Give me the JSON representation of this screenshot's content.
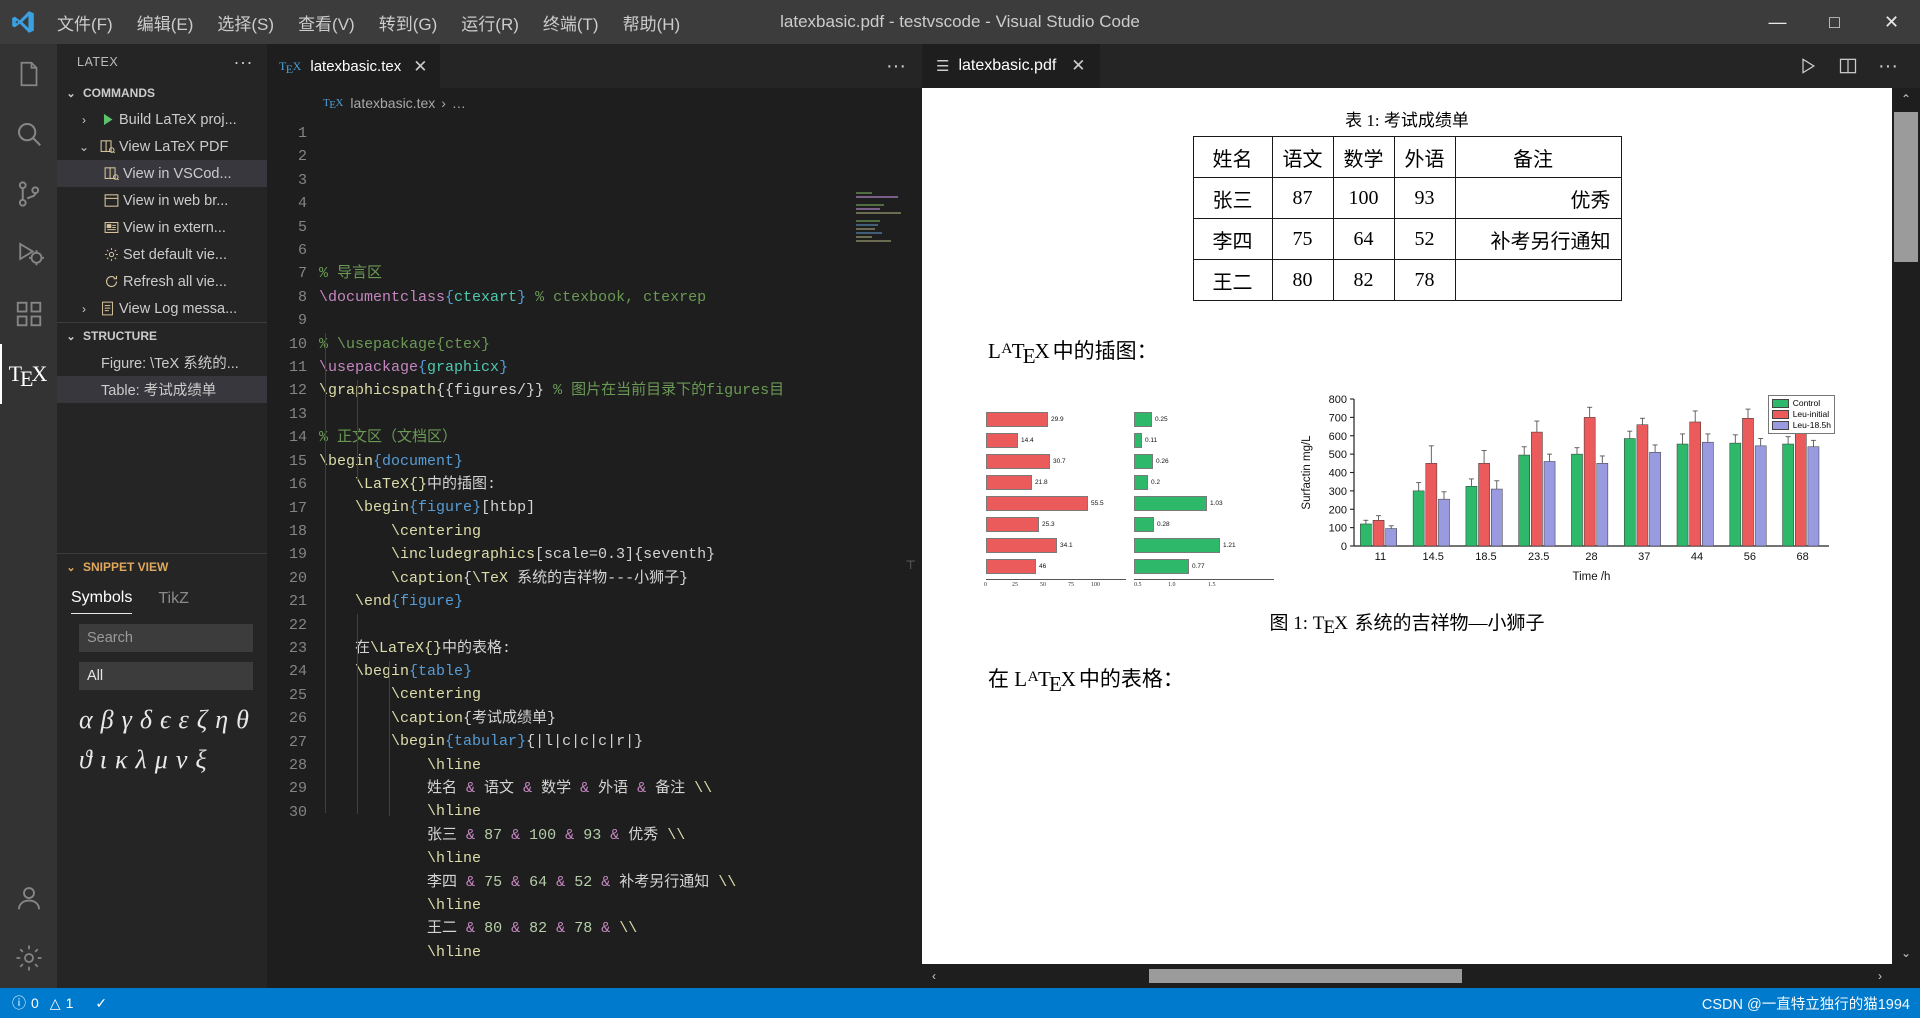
{
  "titlebar": {
    "menus": [
      "文件(F)",
      "编辑(E)",
      "选择(S)",
      "查看(V)",
      "转到(G)",
      "运行(R)",
      "终端(T)",
      "帮助(H)"
    ],
    "window_title": "latexbasic.pdf - testvscode - Visual Studio Code",
    "minimize": "—",
    "maximize": "▢",
    "close": "✕"
  },
  "activitybar": {
    "items": [
      {
        "name": "explorer",
        "icon": "files-icon"
      },
      {
        "name": "search",
        "icon": "search-icon"
      },
      {
        "name": "source-control",
        "icon": "source-control-icon"
      },
      {
        "name": "run-debug",
        "icon": "run-debug-icon"
      },
      {
        "name": "extensions",
        "icon": "extensions-icon"
      },
      {
        "name": "latex",
        "icon": "tex-icon",
        "label": "TeX"
      },
      {
        "name": "accounts",
        "icon": "account-icon"
      },
      {
        "name": "settings",
        "icon": "gear-icon"
      }
    ]
  },
  "sidebar": {
    "title": "LATEX",
    "more_actions": "···",
    "commands": {
      "label": "COMMANDS",
      "items": [
        {
          "label": "Build LaTeX proj...",
          "icon": "play-icon",
          "chevron": "›",
          "indent": 1
        },
        {
          "label": "View LaTeX PDF",
          "icon": "preview-icon",
          "chevron": "⌄",
          "indent": 1
        },
        {
          "label": "View in VSCod...",
          "icon": "preview-icon",
          "chevron": "",
          "indent": 2,
          "selected": true
        },
        {
          "label": "View in web br...",
          "icon": "browser-icon",
          "chevron": "",
          "indent": 2
        },
        {
          "label": "View in extern...",
          "icon": "external-icon",
          "chevron": "",
          "indent": 2
        },
        {
          "label": "Set default vie...",
          "icon": "gear-icon",
          "chevron": "",
          "indent": 2
        },
        {
          "label": "Refresh all vie...",
          "icon": "refresh-icon",
          "chevron": "",
          "indent": 2
        },
        {
          "label": "View Log messa...",
          "icon": "log-icon",
          "chevron": "›",
          "indent": 1
        }
      ]
    },
    "structure": {
      "label": "STRUCTURE",
      "items": [
        {
          "label": "Figure: \\TeX 系统的...",
          "selected": false
        },
        {
          "label": "Table: 考试成绩单",
          "selected": true
        }
      ]
    },
    "snippet_view": {
      "label": "SNIPPET VIEW",
      "tabs": [
        {
          "label": "Symbols",
          "active": true
        },
        {
          "label": "TikZ",
          "active": false
        }
      ],
      "search_placeholder": "Search",
      "filter_value": "All",
      "symbols": [
        "α",
        "β",
        "γ",
        "δ",
        "ϵ",
        "ε",
        "ζ",
        "η",
        "θ",
        "ϑ",
        "ι",
        "κ",
        "λ",
        "μ",
        "ν",
        "ξ"
      ]
    }
  },
  "editor": {
    "tab": {
      "label": "latexbasic.tex",
      "icon": "tex-icon",
      "close": "✕"
    },
    "more_actions": "···",
    "breadcrumb": {
      "file": "latexbasic.tex",
      "sep": "›",
      "rest": "…",
      "icon": "tex-icon"
    },
    "lines": [
      {
        "n": 1,
        "tokens": [
          {
            "t": "% 导言区",
            "c": "c"
          }
        ]
      },
      {
        "n": 2,
        "tokens": [
          {
            "t": "\\documentclass",
            "c": "kw"
          },
          {
            "t": "{",
            "c": "br"
          },
          {
            "t": "ctexart",
            "c": "nm"
          },
          {
            "t": "}",
            "c": "br"
          },
          {
            "t": " % ctexbook, ctexrep",
            "c": "c"
          }
        ]
      },
      {
        "n": 3,
        "tokens": []
      },
      {
        "n": 4,
        "tokens": [
          {
            "t": "% \\usepackage{ctex}",
            "c": "c"
          }
        ]
      },
      {
        "n": 5,
        "tokens": [
          {
            "t": "\\usepackage",
            "c": "kw"
          },
          {
            "t": "{",
            "c": "br"
          },
          {
            "t": "graphicx",
            "c": "nm"
          },
          {
            "t": "}",
            "c": "br"
          }
        ]
      },
      {
        "n": 6,
        "tokens": [
          {
            "t": "\\graphicspath",
            "c": "fn"
          },
          {
            "t": "{{figures/}}",
            "c": "pl"
          },
          {
            "t": " % 图片在当前目录下的figures目",
            "c": "c"
          }
        ]
      },
      {
        "n": 7,
        "tokens": []
      },
      {
        "n": 8,
        "tokens": [
          {
            "t": "% 正文区（文档区）",
            "c": "c"
          }
        ]
      },
      {
        "n": 9,
        "tokens": [
          {
            "t": "\\begin",
            "c": "fn"
          },
          {
            "t": "{",
            "c": "br"
          },
          {
            "t": "document",
            "c": "br"
          },
          {
            "t": "}",
            "c": "br"
          }
        ]
      },
      {
        "n": 10,
        "tokens": [
          {
            "t": "    ",
            "c": "pl"
          },
          {
            "t": "\\LaTeX{}",
            "c": "fn"
          },
          {
            "t": "中的插图:",
            "c": "pl"
          }
        ]
      },
      {
        "n": 11,
        "tokens": [
          {
            "t": "    ",
            "c": "pl"
          },
          {
            "t": "\\begin",
            "c": "fn"
          },
          {
            "t": "{",
            "c": "br"
          },
          {
            "t": "figure",
            "c": "br"
          },
          {
            "t": "}",
            "c": "br"
          },
          {
            "t": "[htbp]",
            "c": "pl"
          }
        ]
      },
      {
        "n": 12,
        "tokens": [
          {
            "t": "        ",
            "c": "pl"
          },
          {
            "t": "\\centering",
            "c": "fn"
          }
        ]
      },
      {
        "n": 13,
        "tokens": [
          {
            "t": "        ",
            "c": "pl"
          },
          {
            "t": "\\includegraphics",
            "c": "fn"
          },
          {
            "t": "[scale=0.3]{seventh}",
            "c": "pl"
          }
        ]
      },
      {
        "n": 14,
        "tokens": [
          {
            "t": "        ",
            "c": "pl"
          },
          {
            "t": "\\caption",
            "c": "fn"
          },
          {
            "t": "{",
            "c": "pl"
          },
          {
            "t": "\\TeX",
            "c": "fn"
          },
          {
            "t": " 系统的吉祥物---小狮子}",
            "c": "pl"
          }
        ]
      },
      {
        "n": 15,
        "tokens": [
          {
            "t": "    ",
            "c": "pl"
          },
          {
            "t": "\\end",
            "c": "fn"
          },
          {
            "t": "{",
            "c": "br"
          },
          {
            "t": "figure",
            "c": "br"
          },
          {
            "t": "}",
            "c": "br"
          }
        ]
      },
      {
        "n": 16,
        "tokens": []
      },
      {
        "n": 17,
        "tokens": [
          {
            "t": "    在",
            "c": "pl"
          },
          {
            "t": "\\LaTeX{}",
            "c": "fn"
          },
          {
            "t": "中的表格:",
            "c": "pl"
          }
        ]
      },
      {
        "n": 18,
        "tokens": [
          {
            "t": "    ",
            "c": "pl"
          },
          {
            "t": "\\begin",
            "c": "fn"
          },
          {
            "t": "{",
            "c": "br"
          },
          {
            "t": "table",
            "c": "br"
          },
          {
            "t": "}",
            "c": "br"
          }
        ]
      },
      {
        "n": 19,
        "tokens": [
          {
            "t": "        ",
            "c": "pl"
          },
          {
            "t": "\\centering",
            "c": "fn"
          }
        ]
      },
      {
        "n": 20,
        "tokens": [
          {
            "t": "        ",
            "c": "pl"
          },
          {
            "t": "\\caption",
            "c": "fn"
          },
          {
            "t": "{考试成绩单}",
            "c": "pl"
          }
        ]
      },
      {
        "n": 21,
        "tokens": [
          {
            "t": "        ",
            "c": "pl"
          },
          {
            "t": "\\begin",
            "c": "fn"
          },
          {
            "t": "{",
            "c": "br"
          },
          {
            "t": "tabular",
            "c": "br"
          },
          {
            "t": "}",
            "c": "br"
          },
          {
            "t": "{|l|c|c|c|r|}",
            "c": "pl"
          }
        ]
      },
      {
        "n": 22,
        "tokens": [
          {
            "t": "            ",
            "c": "pl"
          },
          {
            "t": "\\hline",
            "c": "fn"
          }
        ]
      },
      {
        "n": 23,
        "tokens": [
          {
            "t": "            姓名 ",
            "c": "pl"
          },
          {
            "t": "&",
            "c": "amp"
          },
          {
            "t": " 语文 ",
            "c": "pl"
          },
          {
            "t": "&",
            "c": "amp"
          },
          {
            "t": " 数学 ",
            "c": "pl"
          },
          {
            "t": "&",
            "c": "amp"
          },
          {
            "t": " 外语 ",
            "c": "pl"
          },
          {
            "t": "&",
            "c": "amp"
          },
          {
            "t": " 备注 ",
            "c": "pl"
          },
          {
            "t": "\\\\",
            "c": "fn"
          }
        ]
      },
      {
        "n": 24,
        "tokens": [
          {
            "t": "            ",
            "c": "pl"
          },
          {
            "t": "\\hline",
            "c": "fn"
          }
        ]
      },
      {
        "n": 25,
        "tokens": [
          {
            "t": "            张三 ",
            "c": "pl"
          },
          {
            "t": "&",
            "c": "amp"
          },
          {
            "t": " ",
            "c": "pl"
          },
          {
            "t": "87",
            "c": "nu"
          },
          {
            "t": " ",
            "c": "pl"
          },
          {
            "t": "&",
            "c": "amp"
          },
          {
            "t": " ",
            "c": "pl"
          },
          {
            "t": "100",
            "c": "nu"
          },
          {
            "t": " ",
            "c": "pl"
          },
          {
            "t": "&",
            "c": "amp"
          },
          {
            "t": " ",
            "c": "pl"
          },
          {
            "t": "93",
            "c": "nu"
          },
          {
            "t": " ",
            "c": "pl"
          },
          {
            "t": "&",
            "c": "amp"
          },
          {
            "t": " 优秀 ",
            "c": "pl"
          },
          {
            "t": "\\\\",
            "c": "fn"
          }
        ]
      },
      {
        "n": 26,
        "tokens": [
          {
            "t": "            ",
            "c": "pl"
          },
          {
            "t": "\\hline",
            "c": "fn"
          }
        ]
      },
      {
        "n": 27,
        "tokens": [
          {
            "t": "            李四 ",
            "c": "pl"
          },
          {
            "t": "&",
            "c": "amp"
          },
          {
            "t": " ",
            "c": "pl"
          },
          {
            "t": "75",
            "c": "nu"
          },
          {
            "t": " ",
            "c": "pl"
          },
          {
            "t": "&",
            "c": "amp"
          },
          {
            "t": " ",
            "c": "pl"
          },
          {
            "t": "64",
            "c": "nu"
          },
          {
            "t": " ",
            "c": "pl"
          },
          {
            "t": "&",
            "c": "amp"
          },
          {
            "t": " ",
            "c": "pl"
          },
          {
            "t": "52",
            "c": "nu"
          },
          {
            "t": " ",
            "c": "pl"
          },
          {
            "t": "&",
            "c": "amp"
          },
          {
            "t": " 补考另行通知 ",
            "c": "pl"
          },
          {
            "t": "\\\\",
            "c": "fn"
          }
        ]
      },
      {
        "n": 28,
        "tokens": [
          {
            "t": "            ",
            "c": "pl"
          },
          {
            "t": "\\hline",
            "c": "fn"
          }
        ]
      },
      {
        "n": 29,
        "tokens": [
          {
            "t": "            王二 ",
            "c": "pl"
          },
          {
            "t": "&",
            "c": "amp"
          },
          {
            "t": " ",
            "c": "pl"
          },
          {
            "t": "80",
            "c": "nu"
          },
          {
            "t": " ",
            "c": "pl"
          },
          {
            "t": "&",
            "c": "amp"
          },
          {
            "t": " ",
            "c": "pl"
          },
          {
            "t": "82",
            "c": "nu"
          },
          {
            "t": " ",
            "c": "pl"
          },
          {
            "t": "&",
            "c": "amp"
          },
          {
            "t": " ",
            "c": "pl"
          },
          {
            "t": "78",
            "c": "nu"
          },
          {
            "t": " ",
            "c": "pl"
          },
          {
            "t": "&",
            "c": "amp"
          },
          {
            "t": " ",
            "c": "pl"
          },
          {
            "t": "\\\\",
            "c": "fn"
          }
        ]
      },
      {
        "n": 30,
        "tokens": [
          {
            "t": "            ",
            "c": "pl"
          },
          {
            "t": "\\hline",
            "c": "fn"
          }
        ]
      }
    ]
  },
  "pdf": {
    "tab": {
      "label": "latexbasic.pdf",
      "icon": "pdf-icon",
      "close": "✕"
    },
    "actions": [
      "run-icon",
      "split-editor-icon",
      "more-icon"
    ],
    "content": {
      "table_caption": "表 1: 考试成绩单",
      "table_headers": [
        "姓名",
        "语文",
        "数学",
        "外语",
        "备注"
      ],
      "table_rows": [
        [
          "张三",
          "87",
          "100",
          "93",
          "优秀"
        ],
        [
          "李四",
          "75",
          "64",
          "52",
          "补考另行通知"
        ],
        [
          "王二",
          "80",
          "82",
          "78",
          ""
        ]
      ],
      "para_figure": "中的插图：",
      "para_table": "中的表格：",
      "prefix_zai": "在 ",
      "figure_caption_prefix": "图 1: ",
      "figure_caption_suffix": " 系统的吉祥物—小狮子"
    },
    "hscroll": {
      "left_arrow": "‹",
      "right_arrow": "›"
    },
    "vscroll": {
      "up_arrow": "⌃",
      "down_arrow": "⌄"
    }
  },
  "chart_data": [
    {
      "type": "bar",
      "orientation": "horizontal",
      "title": "",
      "xlabel": "",
      "ylabel": "",
      "series": [
        {
          "name": "red-series",
          "color": "#eb5b5b",
          "values": [
            29.9,
            14.4,
            30.7,
            21.8,
            55.5,
            25.3,
            34.1,
            46.0
          ],
          "xlim": [
            0,
            100
          ]
        },
        {
          "name": "green-series",
          "color": "#2eb86a",
          "values": [
            0.25,
            0.11,
            0.26,
            0.2,
            1.03,
            0.28,
            1.21,
            0.77
          ],
          "xlim": [
            0,
            1.5
          ]
        }
      ],
      "xticks_left": [
        "0",
        "25",
        "50",
        "75",
        "100"
      ],
      "xticks_right": [
        "0.5",
        "1.0",
        "1.5"
      ],
      "grid": false
    },
    {
      "type": "bar",
      "orientation": "vertical",
      "title": "",
      "xlabel": "Time /h",
      "ylabel": "Surfactin mg/L",
      "ylim": [
        0,
        800
      ],
      "yticks": [
        0,
        100,
        200,
        300,
        400,
        500,
        600,
        700,
        800
      ],
      "categories": [
        "11",
        "14.5",
        "18.5",
        "23.5",
        "28",
        "37",
        "44",
        "56",
        "68"
      ],
      "legend_position": "top-right",
      "series": [
        {
          "name": "Control",
          "color": "#2eb86a",
          "values": [
            120,
            300,
            325,
            495,
            500,
            585,
            555,
            560,
            555
          ],
          "errors": [
            20,
            45,
            40,
            45,
            35,
            40,
            55,
            45,
            40
          ]
        },
        {
          "name": "Leu-initial",
          "color": "#eb5b5b",
          "values": [
            140,
            450,
            450,
            620,
            700,
            660,
            675,
            695,
            705
          ],
          "errors": [
            25,
            95,
            70,
            60,
            55,
            35,
            60,
            50,
            45
          ]
        },
        {
          "name": "Leu-18.5h",
          "color": "#9a9ae0",
          "values": [
            95,
            255,
            310,
            460,
            450,
            510,
            565,
            545,
            540
          ],
          "errors": [
            15,
            40,
            45,
            40,
            40,
            40,
            45,
            40,
            35
          ]
        }
      ],
      "grid": false
    }
  ],
  "statusbar": {
    "errors_icon": "error-icon",
    "errors": "0",
    "warnings_icon": "warning-icon",
    "warnings": "1",
    "check_icon": "check-icon",
    "watermark": "CSDN @一直特立独行的猫1994"
  }
}
